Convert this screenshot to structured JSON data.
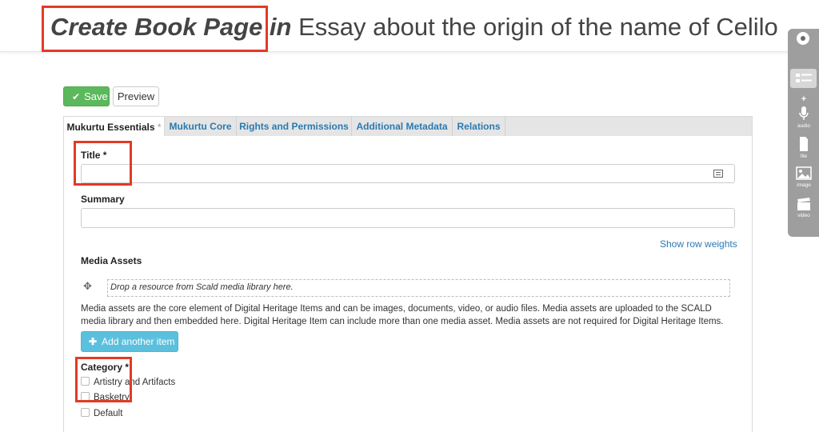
{
  "header": {
    "title_action": "Create Book Page in",
    "title_rest": " Essay about the origin of the name of Celilo"
  },
  "toolbar": {
    "save_label": "Save",
    "preview_label": "Preview"
  },
  "tabs": [
    {
      "label": "Mukurtu Essentials",
      "required_mark": "*",
      "active": true
    },
    {
      "label": "Mukurtu Core"
    },
    {
      "label": "Rights and Permissions"
    },
    {
      "label": "Additional Metadata"
    },
    {
      "label": "Relations"
    }
  ],
  "form": {
    "title_label": "Title *",
    "title_value": "",
    "summary_label": "Summary",
    "summary_value": "",
    "show_row_weights": "Show row weights",
    "media_label": "Media Assets",
    "drop_text": "Drop a resource from Scald media library here.",
    "media_help": "Media assets are the core element of Digital Heritage Items and can be images, documents, video, or audio files. Media assets are uploaded to the SCALD media library and then embedded here. Digital Heritage Item can include more than one media asset. Media assets are not required for Digital Heritage Items.",
    "add_another": "Add another item",
    "category_label": "Category *",
    "categories": [
      "Artistry and Artifacts",
      "Basketry",
      "Default"
    ]
  },
  "sidebar_rail": {
    "items": [
      "",
      "audio",
      "file",
      "image",
      "video"
    ]
  },
  "colors": {
    "highlight": "#e23b24",
    "save": "#5cb85c",
    "add": "#5bc0de",
    "link": "#2a7ab0"
  }
}
